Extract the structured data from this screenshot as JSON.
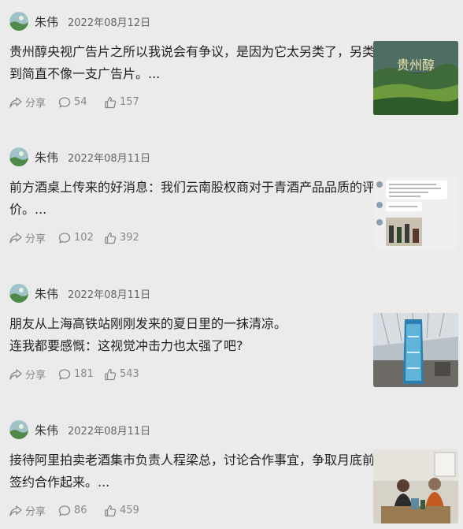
{
  "feed": {
    "posts": [
      {
        "author": "朱伟",
        "date": "2022年08月12日",
        "lines": [
          "贵州醇央视广告片之所以我说会有争议，是因为它太另类了，另类",
          "到简直不像一支广告片。..."
        ],
        "share_label": "分享",
        "comments": "54",
        "likes": "157",
        "thumb_caption": "贵州醇"
      },
      {
        "author": "朱伟",
        "date": "2022年08月11日",
        "lines": [
          "前方酒桌上传来的好消息：我们云南股权商对于青酒产品品质的评",
          "价。..."
        ],
        "share_label": "分享",
        "comments": "102",
        "likes": "392"
      },
      {
        "author": "朱伟",
        "date": "2022年08月11日",
        "lines": [
          "朋友从上海高铁站刚刚发来的夏日里的一抹清凉。",
          "连我都要感慨：这视觉冲击力也太强了吧?"
        ],
        "share_label": "分享",
        "comments": "181",
        "likes": "543"
      },
      {
        "author": "朱伟",
        "date": "2022年08月11日",
        "lines": [
          "接待阿里拍卖老酒集市负责人程梁总，讨论合作事宜，争取月底前",
          "签约合作起来。..."
        ],
        "share_label": "分享",
        "comments": "86",
        "likes": "459"
      }
    ]
  },
  "colors": {
    "background": "#ebebeb",
    "text": "#222222",
    "meta": "#888888"
  }
}
